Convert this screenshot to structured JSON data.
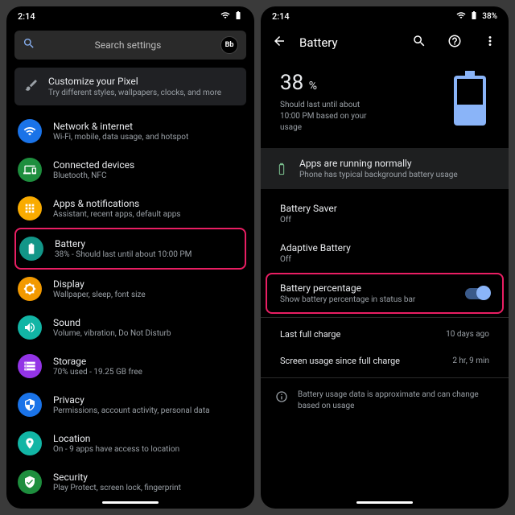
{
  "status": {
    "time": "2:14",
    "pct_text": "38%"
  },
  "left": {
    "search_placeholder": "Search settings",
    "avatar": "Bb",
    "customize": {
      "title": "Customize your Pixel",
      "sub": "Try different styles, wallpapers, clocks, and more"
    },
    "items": [
      {
        "title": "Network & internet",
        "sub": "Wi-Fi, mobile, data usage, and hotspot",
        "color": "#1a73e8",
        "icon": "wifi"
      },
      {
        "title": "Connected devices",
        "sub": "Bluetooth, NFC",
        "color": "#1e8e3e",
        "icon": "devices"
      },
      {
        "title": "Apps & notifications",
        "sub": "Assistant, recent apps, default apps",
        "color": "#f9ab00",
        "icon": "apps"
      },
      {
        "title": "Battery",
        "sub": "38% - Should last until about 10:00 PM",
        "color": "#129688",
        "icon": "battery",
        "highlight": true
      },
      {
        "title": "Display",
        "sub": "Wallpaper, sleep, font size",
        "color": "#f29900",
        "icon": "display"
      },
      {
        "title": "Sound",
        "sub": "Volume, vibration, Do Not Disturb",
        "color": "#12b5a5",
        "icon": "sound"
      },
      {
        "title": "Storage",
        "sub": "70% used - 19.25 GB free",
        "color": "#9334e6",
        "icon": "storage"
      },
      {
        "title": "Privacy",
        "sub": "Permissions, account activity, personal data",
        "color": "#1a73e8",
        "icon": "privacy"
      },
      {
        "title": "Location",
        "sub": "On - 9 apps have access to location",
        "color": "#12b5a5",
        "icon": "location"
      },
      {
        "title": "Security",
        "sub": "Play Protect, screen lock, fingerprint",
        "color": "#1e8e3e",
        "icon": "security"
      }
    ]
  },
  "right": {
    "title": "Battery",
    "pct_num": "38",
    "pct_sym": "%",
    "desc": "Should last until about 10:00 PM based on your usage",
    "card": {
      "title": "Apps are running normally",
      "sub": "Phone has typical background battery usage"
    },
    "saver": {
      "title": "Battery Saver",
      "sub": "Off"
    },
    "adaptive": {
      "title": "Adaptive Battery",
      "sub": "Off"
    },
    "pct_setting": {
      "title": "Battery percentage",
      "sub": "Show battery percentage in status bar"
    },
    "last_charge": {
      "label": "Last full charge",
      "value": "10 days ago"
    },
    "screen_usage": {
      "label": "Screen usage since full charge",
      "value": "2 hr, 9 min"
    },
    "footnote": "Battery usage data is approximate and can change based on usage"
  }
}
